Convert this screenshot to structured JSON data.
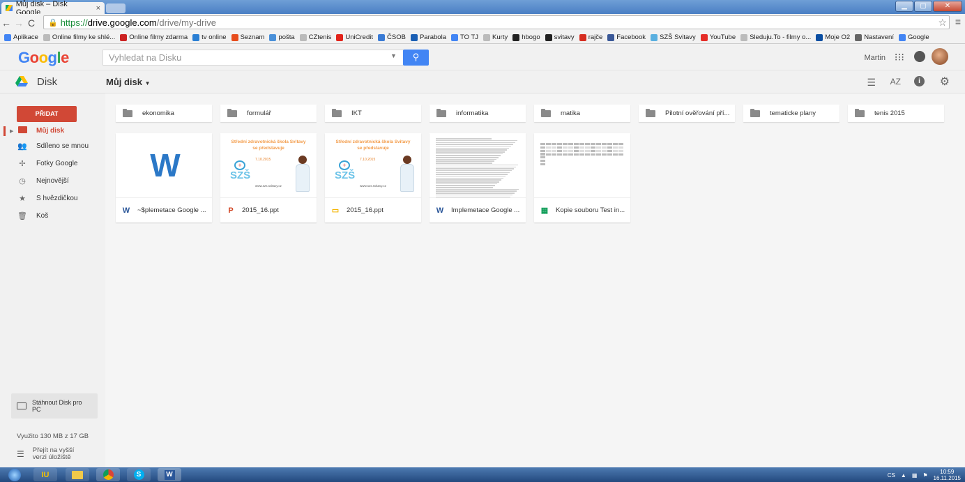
{
  "browser": {
    "tab_title": "Můj disk – Disk Google",
    "tab_close": "×",
    "url_scheme": "https://",
    "url_host": "drive.google.com",
    "url_path": "/drive/my-drive",
    "bookmarks": [
      {
        "label": "Aplikace",
        "color": "#4285f4"
      },
      {
        "label": "Online filmy ke shlé...",
        "color": "#bbbbbb"
      },
      {
        "label": "Online filmy zdarma",
        "color": "#cc2222"
      },
      {
        "label": "tv online",
        "color": "#2a7fd4"
      },
      {
        "label": "Seznam",
        "color": "#e74c1c"
      },
      {
        "label": "pošta",
        "color": "#4a90d9"
      },
      {
        "label": "CZtenis",
        "color": "#bbbbbb"
      },
      {
        "label": "UniCredit",
        "color": "#e2231a"
      },
      {
        "label": "ČSOB",
        "color": "#3a7bd5"
      },
      {
        "label": "Parabola",
        "color": "#1a5fb4"
      },
      {
        "label": "TO TJ",
        "color": "#4285f4"
      },
      {
        "label": "Kurty",
        "color": "#bbbbbb"
      },
      {
        "label": "hbogo",
        "color": "#222222"
      },
      {
        "label": "svitavy",
        "color": "#222222"
      },
      {
        "label": "rajče",
        "color": "#d62d20"
      },
      {
        "label": "Facebook",
        "color": "#3b5998"
      },
      {
        "label": "SZŠ Svitavy",
        "color": "#5ab0e0"
      },
      {
        "label": "YouTube",
        "color": "#e52d27"
      },
      {
        "label": "Sleduju.To - filmy o...",
        "color": "#bbbbbb"
      },
      {
        "label": "Moje O2",
        "color": "#0a4ea2"
      },
      {
        "label": "Nastavení",
        "color": "#666666"
      },
      {
        "label": "Google",
        "color": "#4285f4"
      }
    ]
  },
  "header": {
    "logo": "Google",
    "search_placeholder": "Vyhledat na Disku",
    "user": "Martin"
  },
  "toolbar": {
    "app_name": "Disk",
    "breadcrumb": "Můj disk"
  },
  "sidebar": {
    "new_button": "PŘIDAT",
    "items": [
      {
        "label": "Můj disk",
        "icon": "my-drive-icon"
      },
      {
        "label": "Sdíleno se mnou",
        "icon": "shared-icon"
      },
      {
        "label": "Fotky Google",
        "icon": "photos-icon"
      },
      {
        "label": "Nejnovější",
        "icon": "clock-icon"
      },
      {
        "label": "S hvězdičkou",
        "icon": "star-icon"
      },
      {
        "label": "Koš",
        "icon": "trash-icon"
      }
    ],
    "download_line1": "Stáhnout Disk pro",
    "download_line2": "PC",
    "storage": "Využito 130 MB z 17 GB",
    "upgrade_line1": "Přejít na vyšší",
    "upgrade_line2": "verzi úložiště"
  },
  "folders": [
    {
      "name": "ekonomika",
      "shared": false
    },
    {
      "name": "formulář",
      "shared": false
    },
    {
      "name": "IKT",
      "shared": false
    },
    {
      "name": "informatika",
      "shared": false
    },
    {
      "name": "matika",
      "shared": false
    },
    {
      "name": "Pilotní ověřování pří...",
      "shared": true
    },
    {
      "name": "tematicke plany",
      "shared": false
    },
    {
      "name": "tenis 2015",
      "shared": false
    }
  ],
  "files": [
    {
      "name": "~$plemetace Google ...",
      "type": "word",
      "type_glyph": "W",
      "type_color": "#2a5699",
      "thumb": "word-logo"
    },
    {
      "name": "2015_16.ppt",
      "type": "powerpoint",
      "type_glyph": "P",
      "type_color": "#d24726",
      "thumb": "slide"
    },
    {
      "name": "2015_16.ppt",
      "type": "slides",
      "type_glyph": "▭",
      "type_color": "#f4b400",
      "thumb": "slide"
    },
    {
      "name": "Implemetace Google ...",
      "type": "word",
      "type_glyph": "W",
      "type_color": "#2a5699",
      "thumb": "text"
    },
    {
      "name": "Kopie souboru Test in...",
      "type": "sheet",
      "type_glyph": "▦",
      "type_color": "#0f9d58",
      "thumb": "sheet"
    }
  ],
  "slide_thumb": {
    "title_line1": "Střední zdravotnická škola Svitavy",
    "title_line2": "se představuje",
    "date": "7.10.2015",
    "logo": "SZŠ",
    "url": "www.szs.svitavy.cz"
  },
  "taskbar": {
    "lang": "CS",
    "time": "10:59",
    "date": "16.11.2015"
  }
}
